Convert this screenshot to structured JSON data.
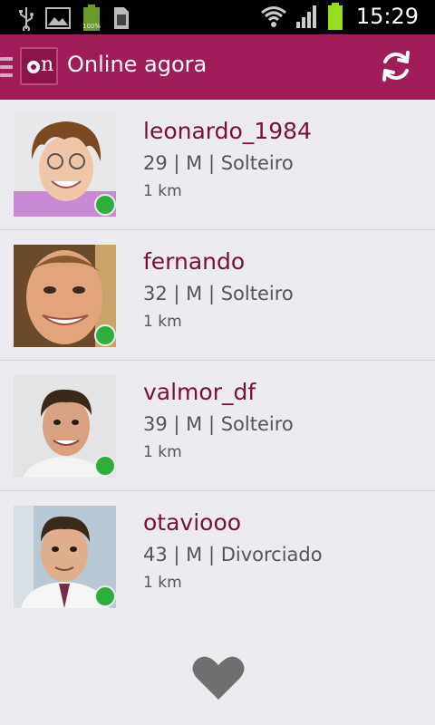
{
  "status_bar": {
    "time": "15:29",
    "battery_label": "100%",
    "icons": [
      "usb-icon",
      "image-icon",
      "battery-small-icon",
      "sim-icon",
      "wifi-icon",
      "signal-icon",
      "battery-icon"
    ]
  },
  "appbar": {
    "title": "Online agora",
    "logo_text": "on",
    "color": "#a01d5a"
  },
  "users": [
    {
      "name": "leonardo_1984",
      "details": "29 | M | Solteiro",
      "distance": "1 km",
      "online": true
    },
    {
      "name": "fernando",
      "details": "32 | M | Solteiro",
      "distance": "1 km",
      "online": true
    },
    {
      "name": "valmor_df",
      "details": "39 | M | Solteiro",
      "distance": "1 km",
      "online": true
    },
    {
      "name": "otaviooo",
      "details": "43 | M | Divorciado",
      "distance": "1 km",
      "online": true
    }
  ],
  "colors": {
    "online": "#2fae3c",
    "username": "#7a0f3d",
    "background": "#ececf0"
  }
}
